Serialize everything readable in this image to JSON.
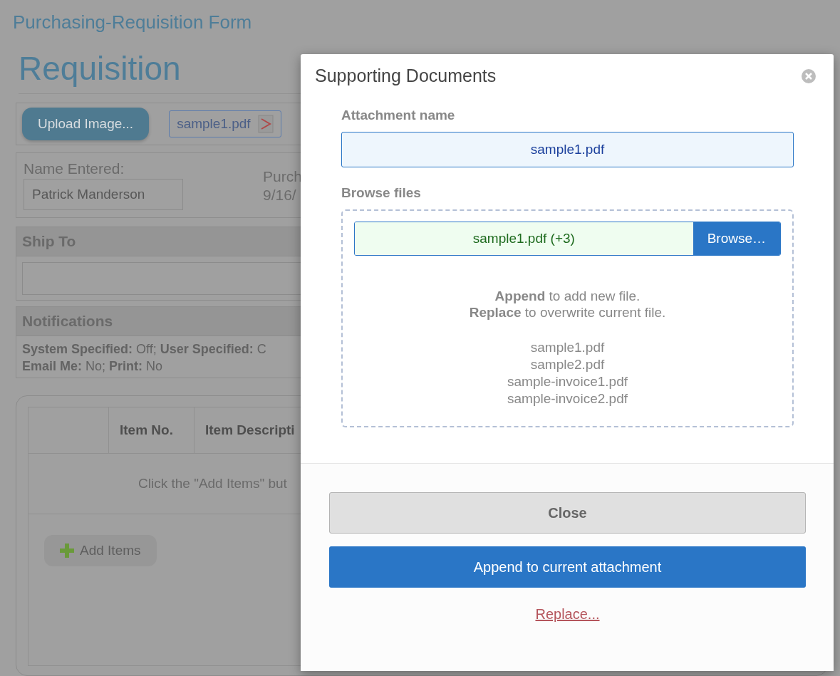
{
  "page_title": "Purchasing-Requisition Form",
  "heading": "Requisition",
  "upload_button": "Upload Image...",
  "attachment_chip": "sample1.pdf",
  "name_field": {
    "label": "Name Entered:",
    "value": "Patrick Manderson"
  },
  "purchase": {
    "label": "Purch",
    "value": "9/16/"
  },
  "ship_to": {
    "title": "Ship To"
  },
  "notifications": {
    "title": "Notifications",
    "lines": [
      "**System Specified:** Off; **User Specified:** C",
      "**Email Me:** No; **Print:** No"
    ]
  },
  "items_table": {
    "columns": [
      "Item No.",
      "Item Descripti"
    ],
    "empty_message": "Click the \"Add Items\" but",
    "add_button": "Add Items"
  },
  "dialog": {
    "title": "Supporting Documents",
    "attachment_label": "Attachment name",
    "attachment_value": "sample1.pdf",
    "browse_label": "Browse files",
    "file_value": "sample1.pdf (+3)",
    "browse_button": "Browse…",
    "info_lines": [
      "**Append** to add new file.",
      "**Replace** to overwrite current file."
    ],
    "files": [
      "sample1.pdf",
      "sample2.pdf",
      "sample-invoice1.pdf",
      "sample-invoice2.pdf"
    ],
    "close_button": "Close",
    "append_button": "Append to current attachment",
    "replace_link": "Replace..."
  }
}
